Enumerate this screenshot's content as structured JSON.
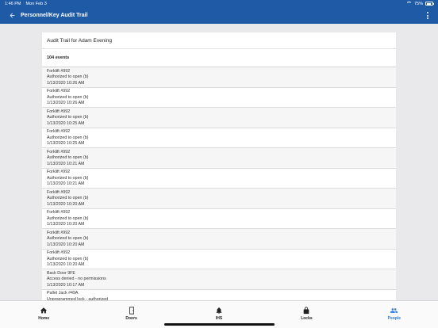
{
  "status_bar": {
    "time": "1:46 PM",
    "date": "Mon Feb 3",
    "battery": "75%",
    "battery_level": 0.75
  },
  "app_bar": {
    "title": "Personnel/Key Audit Trail"
  },
  "card": {
    "title": "Audit Trail for Adam Evening",
    "event_count": "104 events"
  },
  "events": [
    {
      "name": "Forklift #992",
      "status": "Authorized to open (b)",
      "time": "1/13/2020 10:26 AM"
    },
    {
      "name": "Forklift #992",
      "status": "Authorized to open (b)",
      "time": "1/13/2020 10:26 AM"
    },
    {
      "name": "Forklift #992",
      "status": "Authorized to open (b)",
      "time": "1/13/2020 10:25 AM"
    },
    {
      "name": "Forklift #992",
      "status": "Authorized to open (b)",
      "time": "1/13/2020 10:25 AM"
    },
    {
      "name": "Forklift #992",
      "status": "Authorized to open (b)",
      "time": "1/13/2020 10:21 AM"
    },
    {
      "name": "Forklift #992",
      "status": "Authorized to open (b)",
      "time": "1/13/2020 10:21 AM"
    },
    {
      "name": "Forklift #992",
      "status": "Authorized to open (b)",
      "time": "1/13/2020 10:20 AM"
    },
    {
      "name": "Forklift #992",
      "status": "Authorized to open (b)",
      "time": "1/13/2020 10:20 AM"
    },
    {
      "name": "Forklift #992",
      "status": "Authorized to open (b)",
      "time": "1/13/2020 10:20 AM"
    },
    {
      "name": "Forklift #992",
      "status": "Authorized to open (b)",
      "time": "1/13/2020 10:20 AM"
    },
    {
      "name": "Back Door 9FE",
      "status": "Access denied - no permissions",
      "time": "1/13/2020 10:17 AM"
    },
    {
      "name": "Pallet Jack #49A",
      "status": "Unprogrammed lock - authorized",
      "time": ""
    }
  ],
  "tabs": [
    {
      "label": "Home",
      "icon": "home-icon"
    },
    {
      "label": "Doors",
      "icon": "door-icon"
    },
    {
      "label": "IHS",
      "icon": "bell-icon"
    },
    {
      "label": "Locks",
      "icon": "lock-icon"
    },
    {
      "label": "People",
      "icon": "people-icon",
      "active": true
    }
  ],
  "colors": {
    "header": "#1f5aa6",
    "active_tab": "#2c7be0"
  }
}
